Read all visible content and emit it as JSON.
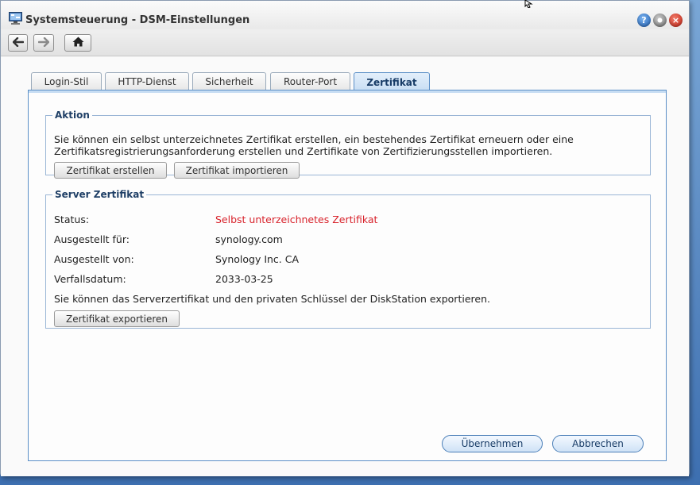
{
  "window": {
    "title": "Systemsteuerung - DSM-Einstellungen",
    "controls": {
      "help": "?",
      "minimize": "",
      "close": "×"
    }
  },
  "toolbar": {
    "back_icon": "arrow-left-icon",
    "forward_icon": "arrow-right-icon",
    "home_icon": "home-icon"
  },
  "tabs": [
    {
      "label": "Login-Stil",
      "active": false
    },
    {
      "label": "HTTP-Dienst",
      "active": false
    },
    {
      "label": "Sicherheit",
      "active": false
    },
    {
      "label": "Router-Port",
      "active": false
    },
    {
      "label": "Zertifikat",
      "active": true
    }
  ],
  "aktion": {
    "legend": "Aktion",
    "description_line1": "Sie können ein selbst unterzeichnetes Zertifikat erstellen, ein bestehendes Zertifikat erneuern oder eine",
    "description_line2": "Zertifikatsregistrierungsanforderung erstellen und Zertifikate von Zertifizierungsstellen importieren.",
    "create_button": "Zertifikat erstellen",
    "import_button": "Zertifikat importieren"
  },
  "server": {
    "legend": "Server Zertifikat",
    "rows": [
      {
        "label": "Status:",
        "value": "Selbst unterzeichnetes Zertifikat"
      },
      {
        "label": "Ausgestellt für:",
        "value": "synology.com"
      },
      {
        "label": "Ausgestellt von:",
        "value": "Synology Inc. CA"
      },
      {
        "label": "Verfallsdatum:",
        "value": "2033-03-25"
      }
    ],
    "export_note": "Sie können das Serverzertifikat und den privaten Schlüssel der DiskStation exportieren.",
    "export_button": "Zertifikat exportieren"
  },
  "footer": {
    "apply_button": "Übernehmen",
    "cancel_button": "Abbrechen"
  },
  "colors": {
    "accent": "#5b8fc7",
    "status_warning": "#d8222b"
  }
}
